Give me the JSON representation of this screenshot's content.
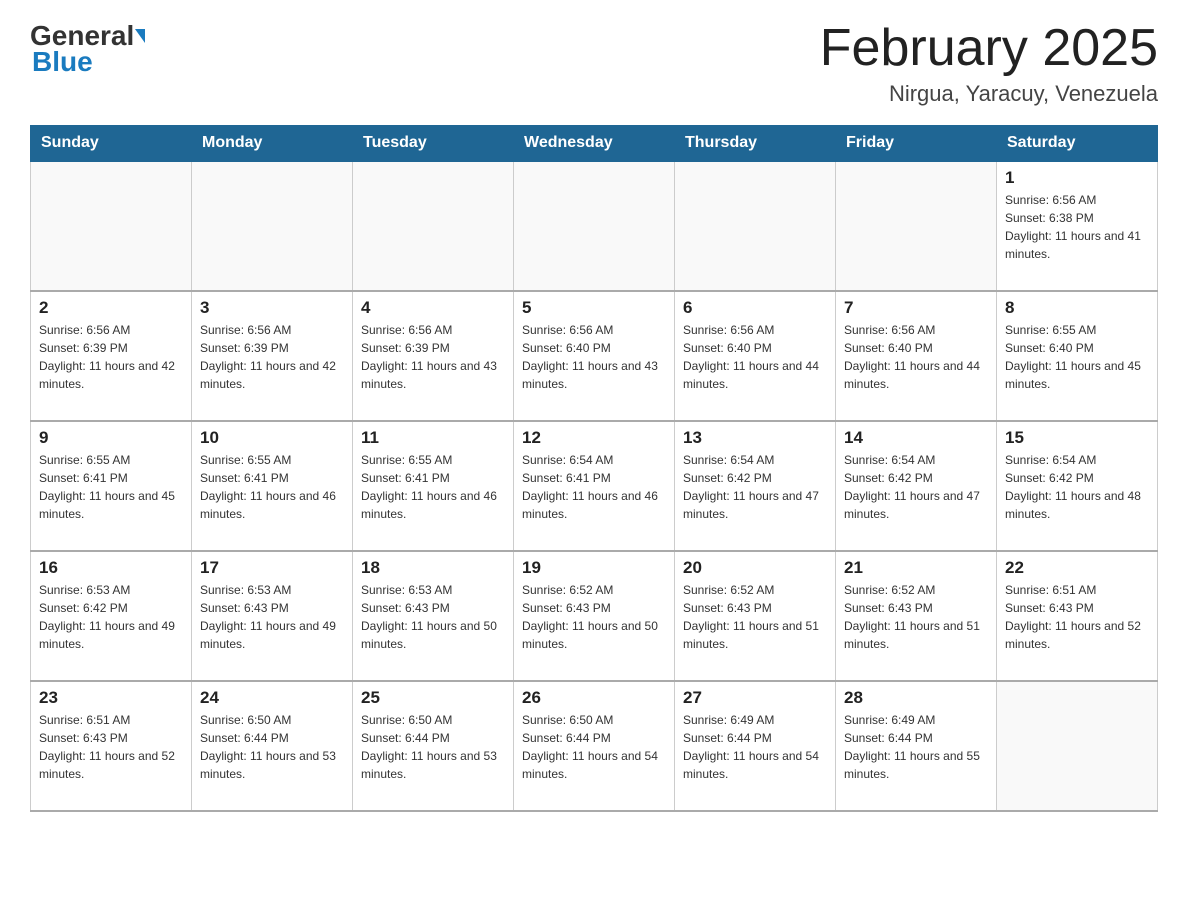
{
  "header": {
    "logo_general": "General",
    "logo_blue": "Blue",
    "month_title": "February 2025",
    "location": "Nirgua, Yaracuy, Venezuela"
  },
  "days_of_week": [
    "Sunday",
    "Monday",
    "Tuesday",
    "Wednesday",
    "Thursday",
    "Friday",
    "Saturday"
  ],
  "weeks": [
    [
      {
        "day": "",
        "info": ""
      },
      {
        "day": "",
        "info": ""
      },
      {
        "day": "",
        "info": ""
      },
      {
        "day": "",
        "info": ""
      },
      {
        "day": "",
        "info": ""
      },
      {
        "day": "",
        "info": ""
      },
      {
        "day": "1",
        "info": "Sunrise: 6:56 AM\nSunset: 6:38 PM\nDaylight: 11 hours and 41 minutes."
      }
    ],
    [
      {
        "day": "2",
        "info": "Sunrise: 6:56 AM\nSunset: 6:39 PM\nDaylight: 11 hours and 42 minutes."
      },
      {
        "day": "3",
        "info": "Sunrise: 6:56 AM\nSunset: 6:39 PM\nDaylight: 11 hours and 42 minutes."
      },
      {
        "day": "4",
        "info": "Sunrise: 6:56 AM\nSunset: 6:39 PM\nDaylight: 11 hours and 43 minutes."
      },
      {
        "day": "5",
        "info": "Sunrise: 6:56 AM\nSunset: 6:40 PM\nDaylight: 11 hours and 43 minutes."
      },
      {
        "day": "6",
        "info": "Sunrise: 6:56 AM\nSunset: 6:40 PM\nDaylight: 11 hours and 44 minutes."
      },
      {
        "day": "7",
        "info": "Sunrise: 6:56 AM\nSunset: 6:40 PM\nDaylight: 11 hours and 44 minutes."
      },
      {
        "day": "8",
        "info": "Sunrise: 6:55 AM\nSunset: 6:40 PM\nDaylight: 11 hours and 45 minutes."
      }
    ],
    [
      {
        "day": "9",
        "info": "Sunrise: 6:55 AM\nSunset: 6:41 PM\nDaylight: 11 hours and 45 minutes."
      },
      {
        "day": "10",
        "info": "Sunrise: 6:55 AM\nSunset: 6:41 PM\nDaylight: 11 hours and 46 minutes."
      },
      {
        "day": "11",
        "info": "Sunrise: 6:55 AM\nSunset: 6:41 PM\nDaylight: 11 hours and 46 minutes."
      },
      {
        "day": "12",
        "info": "Sunrise: 6:54 AM\nSunset: 6:41 PM\nDaylight: 11 hours and 46 minutes."
      },
      {
        "day": "13",
        "info": "Sunrise: 6:54 AM\nSunset: 6:42 PM\nDaylight: 11 hours and 47 minutes."
      },
      {
        "day": "14",
        "info": "Sunrise: 6:54 AM\nSunset: 6:42 PM\nDaylight: 11 hours and 47 minutes."
      },
      {
        "day": "15",
        "info": "Sunrise: 6:54 AM\nSunset: 6:42 PM\nDaylight: 11 hours and 48 minutes."
      }
    ],
    [
      {
        "day": "16",
        "info": "Sunrise: 6:53 AM\nSunset: 6:42 PM\nDaylight: 11 hours and 49 minutes."
      },
      {
        "day": "17",
        "info": "Sunrise: 6:53 AM\nSunset: 6:43 PM\nDaylight: 11 hours and 49 minutes."
      },
      {
        "day": "18",
        "info": "Sunrise: 6:53 AM\nSunset: 6:43 PM\nDaylight: 11 hours and 50 minutes."
      },
      {
        "day": "19",
        "info": "Sunrise: 6:52 AM\nSunset: 6:43 PM\nDaylight: 11 hours and 50 minutes."
      },
      {
        "day": "20",
        "info": "Sunrise: 6:52 AM\nSunset: 6:43 PM\nDaylight: 11 hours and 51 minutes."
      },
      {
        "day": "21",
        "info": "Sunrise: 6:52 AM\nSunset: 6:43 PM\nDaylight: 11 hours and 51 minutes."
      },
      {
        "day": "22",
        "info": "Sunrise: 6:51 AM\nSunset: 6:43 PM\nDaylight: 11 hours and 52 minutes."
      }
    ],
    [
      {
        "day": "23",
        "info": "Sunrise: 6:51 AM\nSunset: 6:43 PM\nDaylight: 11 hours and 52 minutes."
      },
      {
        "day": "24",
        "info": "Sunrise: 6:50 AM\nSunset: 6:44 PM\nDaylight: 11 hours and 53 minutes."
      },
      {
        "day": "25",
        "info": "Sunrise: 6:50 AM\nSunset: 6:44 PM\nDaylight: 11 hours and 53 minutes."
      },
      {
        "day": "26",
        "info": "Sunrise: 6:50 AM\nSunset: 6:44 PM\nDaylight: 11 hours and 54 minutes."
      },
      {
        "day": "27",
        "info": "Sunrise: 6:49 AM\nSunset: 6:44 PM\nDaylight: 11 hours and 54 minutes."
      },
      {
        "day": "28",
        "info": "Sunrise: 6:49 AM\nSunset: 6:44 PM\nDaylight: 11 hours and 55 minutes."
      },
      {
        "day": "",
        "info": ""
      }
    ]
  ]
}
